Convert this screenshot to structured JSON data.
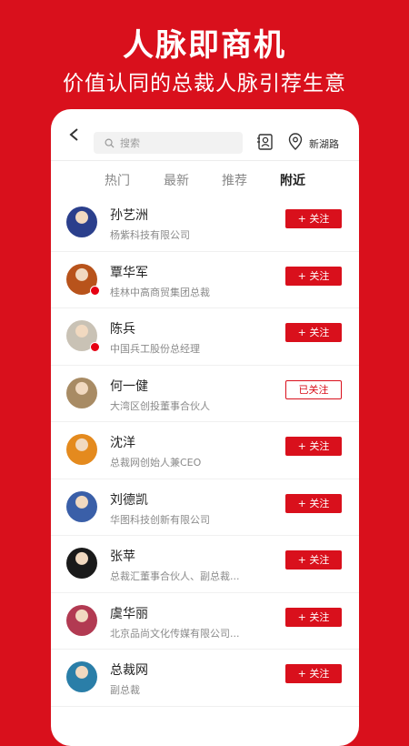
{
  "promo": {
    "title": "人脉即商机",
    "subtitle": "价值认同的总裁人脉引荐生意"
  },
  "topbar": {
    "search_placeholder": "搜索",
    "location": "新湖路"
  },
  "tabs": [
    {
      "label": "热门",
      "active": false
    },
    {
      "label": "最新",
      "active": false
    },
    {
      "label": "推荐",
      "active": false
    },
    {
      "label": "附近",
      "active": true
    }
  ],
  "contacts": [
    {
      "name": "孙艺洲",
      "title": "杨紫科技有限公司",
      "button": "+ 关注",
      "followed": false,
      "badge": false,
      "avatar_color": "#2b3f8c"
    },
    {
      "name": "覃华军",
      "title": "桂林中高商贸集团总裁",
      "button": "+ 关注",
      "followed": false,
      "badge": true,
      "avatar_color": "#b8531b"
    },
    {
      "name": "陈兵",
      "title": "中国兵工股份总经理",
      "button": "+ 关注",
      "followed": false,
      "badge": true,
      "avatar_color": "#c9c2b5"
    },
    {
      "name": "何一健",
      "title": "大湾区创投董事合伙人",
      "button": "已关注",
      "followed": true,
      "badge": false,
      "avatar_color": "#a88b64"
    },
    {
      "name": "沈洋",
      "title": "总裁网创始人兼CEO",
      "button": "+ 关注",
      "followed": false,
      "badge": false,
      "avatar_color": "#e48a1e"
    },
    {
      "name": "刘德凯",
      "title": "华图科技创新有限公司",
      "button": "+ 关注",
      "followed": false,
      "badge": false,
      "avatar_color": "#3a5fa8"
    },
    {
      "name": "张苹",
      "title": "总裁汇董事合伙人、副总裁...",
      "button": "+ 关注",
      "followed": false,
      "badge": false,
      "avatar_color": "#1a1a1a"
    },
    {
      "name": "虞华丽",
      "title": "北京品尚文化传媒有限公司...",
      "button": "+ 关注",
      "followed": false,
      "badge": false,
      "avatar_color": "#b23a52"
    },
    {
      "name": "总裁网",
      "title": "副总裁",
      "button": "+ 关注",
      "followed": false,
      "badge": false,
      "avatar_color": "#2a7ea8"
    }
  ]
}
